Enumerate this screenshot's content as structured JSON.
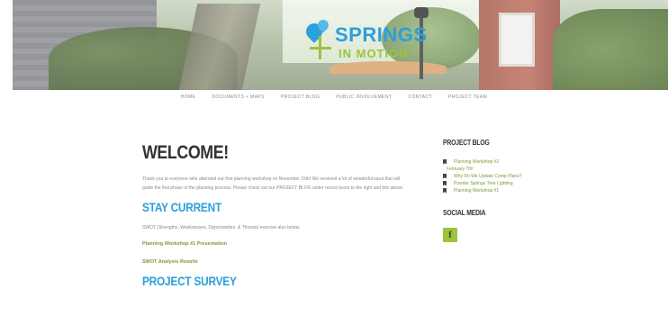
{
  "brand": {
    "logo_line1": "SPRINGS",
    "logo_line2": "IN MOTION",
    "colors": {
      "blue": "#2aa0dc",
      "green": "#9dc33b",
      "link_green": "#7b9a3a"
    }
  },
  "nav": {
    "items": [
      {
        "label": "HOME"
      },
      {
        "label": "DOCUMENTS + MAPS"
      },
      {
        "label": "PROJECT BLOG"
      },
      {
        "label": "PUBLIC INVOLVEMENT"
      },
      {
        "label": "CONTACT"
      },
      {
        "label": "PROJECT TEAM"
      }
    ]
  },
  "main": {
    "title": "WELCOME!",
    "intro": "Thank you to everyone who attended our first planning workshop on November 15th! We received a lot of wonderful input that will guide the first phase of the planning process. Please check out our PROJECT BLOG under recent posts to the right and link above.",
    "stay_current": {
      "heading": "STAY CURRENT",
      "text": "SWOT (Strengths, Weaknesses, Opportunities, & Threats) exercise also below.",
      "link1": "Planning Workshop #1 Presentation",
      "link2": "SWOT Analysis Results"
    },
    "survey_heading": "PROJECT SURVEY"
  },
  "sidebar": {
    "blog_heading": "PROJECT BLOG",
    "posts": [
      {
        "label": "Planning Workshop #2"
      },
      {
        "label": "February 7th!"
      },
      {
        "label": "Why Do We Update Comp Plans?"
      },
      {
        "label": "Powder Springs Tree Lighting"
      },
      {
        "label": "Planning Workshop #1"
      }
    ],
    "social_heading": "SOCIAL MEDIA",
    "facebook_glyph": "f",
    "icons": {
      "post": "bookmark-icon",
      "social": "facebook-icon"
    }
  }
}
